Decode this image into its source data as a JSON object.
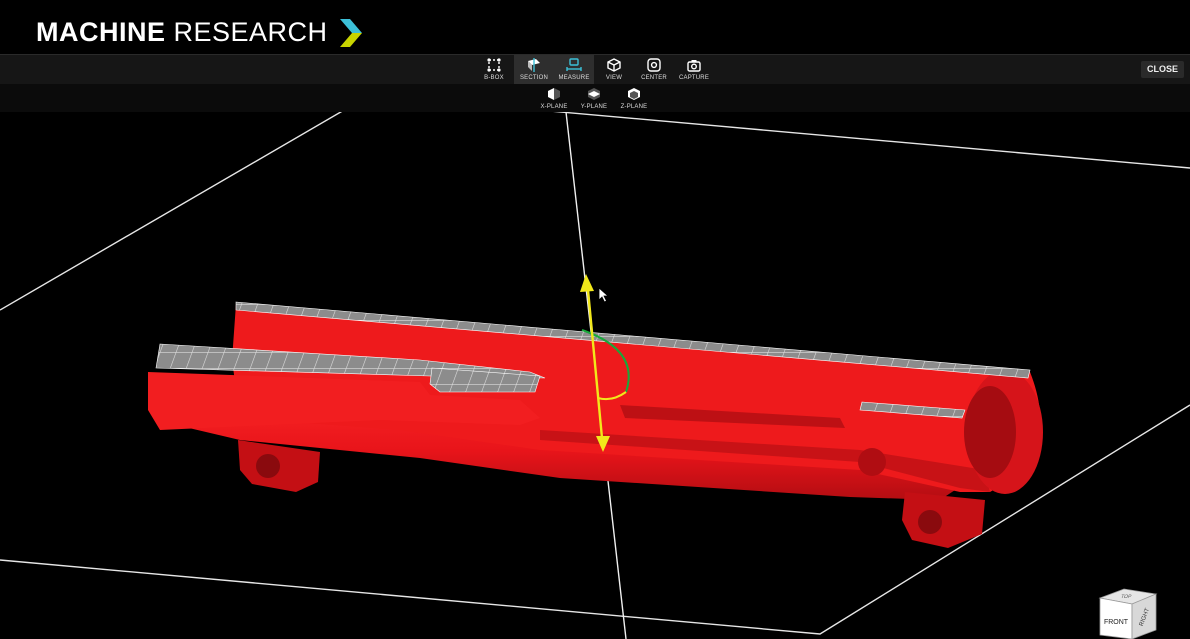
{
  "app": {
    "brand_bold": "MACHINE",
    "brand_light": "RESEARCH",
    "brand_accent_color": "#3cc0d8",
    "brand_accent_color2": "#c8d400"
  },
  "toolbar": {
    "tools": [
      {
        "label": "B-BOX",
        "icon": "bbox-icon",
        "active": false
      },
      {
        "label": "SECTION",
        "icon": "section-icon",
        "active": true
      },
      {
        "label": "MEASURE",
        "icon": "measure-icon",
        "active": true
      },
      {
        "label": "VIEW",
        "icon": "view-cube-icon",
        "active": false
      },
      {
        "label": "CENTER",
        "icon": "center-icon",
        "active": false
      },
      {
        "label": "CAPTURE",
        "icon": "camera-icon",
        "active": false
      }
    ],
    "close_label": "CLOSE"
  },
  "subtoolbar": {
    "tools": [
      {
        "label": "X-PLANE",
        "icon": "x-plane-icon"
      },
      {
        "label": "Y-PLANE",
        "icon": "y-plane-icon"
      },
      {
        "label": "Z-PLANE",
        "icon": "z-plane-icon"
      }
    ]
  },
  "viewport": {
    "model_color": "#e8141a",
    "section_color": "#8a8a8a",
    "gizmo_axis_color": "#f2e81a",
    "gizmo_ring_color": "#19a83a",
    "bounding_box_color": "#e6e6e6"
  },
  "view_cube": {
    "front": "FRONT",
    "right": "RIGHT",
    "top": "TOP"
  }
}
